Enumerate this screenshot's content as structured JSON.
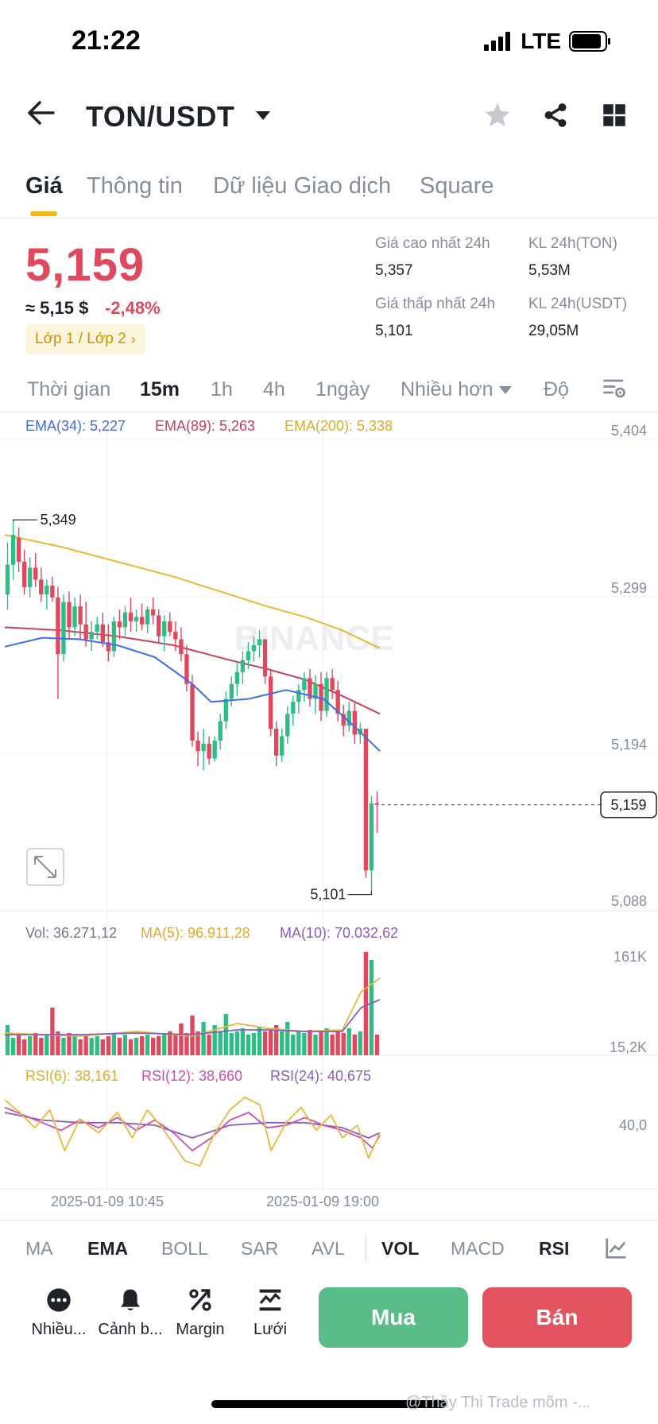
{
  "status": {
    "time": "21:22",
    "network": "LTE"
  },
  "header": {
    "pair": "TON/USDT"
  },
  "tabs": [
    {
      "label": "Giá",
      "active": true
    },
    {
      "label": "Thông tin",
      "active": false
    },
    {
      "label": "Dữ liệu Giao dịch",
      "active": false
    },
    {
      "label": "Square",
      "active": false
    }
  ],
  "price": {
    "last": "5,159",
    "usd": "≈ 5,15 $",
    "change": "-2,48%",
    "layer_badge": "Lớp 1 / Lớp 2"
  },
  "stats": {
    "high_label": "Giá cao nhất 24h",
    "high": "5,357",
    "low_label": "Giá thấp nhất 24h",
    "low": "5,101",
    "vol_ton_label": "KL 24h(TON)",
    "vol_ton": "5,53M",
    "vol_usdt_label": "KL 24h(USDT)",
    "vol_usdt": "29,05M"
  },
  "intervals": [
    {
      "label": "Thời gian",
      "active": false
    },
    {
      "label": "15m",
      "active": true
    },
    {
      "label": "1h",
      "active": false
    },
    {
      "label": "4h",
      "active": false
    },
    {
      "label": "1ngày",
      "active": false
    },
    {
      "label": "Nhiều hơn",
      "active": false
    },
    {
      "label": "Độ",
      "active": false
    }
  ],
  "indicators": {
    "ema34": "EMA(34): 5,227",
    "ema89": "EMA(89): 5,263",
    "ema200": "EMA(200): 5,338",
    "vol": "Vol: 36.271,12",
    "ma5": "MA(5): 96.911,28",
    "ma10": "MA(10): 70.032,62",
    "rsi6": "RSI(6): 38,161",
    "rsi12": "RSI(12): 38,660",
    "rsi24": "RSI(24): 40,675"
  },
  "colors": {
    "up": "#2ebd85",
    "down": "#e0485e",
    "ema34": "#3f6ee6",
    "ema89": "#c8405a",
    "ema200": "#e6b93c",
    "ma5": "#e6b93c",
    "ma10": "#8a5cc0",
    "rsi6": "#e6b93c",
    "rsi12": "#c850b0",
    "rsi24": "#8a5cc0",
    "buy": "#58bd86",
    "sell": "#e3525f",
    "accent": "#f0b90b"
  },
  "chart_data": {
    "type": "candlestick",
    "price_axis_ticks": [
      "5,404",
      "5,299",
      "5,194",
      "5,088"
    ],
    "price_ylim": [
      5.088,
      5.404
    ],
    "current_price_label": "5,159",
    "current_price": 5.159,
    "high_marker": "5,349",
    "low_marker": "5,101",
    "volume_axis_ticks": [
      "161K",
      "15,2K"
    ],
    "rsi_axis_ticks": [
      "40,0"
    ],
    "x_tick_labels": [
      "2025-01-09 10:45",
      "2025-01-09 19:00"
    ],
    "candles_ohlc": [
      [
        5.3,
        5.335,
        5.29,
        5.32
      ],
      [
        5.32,
        5.349,
        5.31,
        5.34
      ],
      [
        5.338,
        5.345,
        5.315,
        5.322
      ],
      [
        5.322,
        5.33,
        5.3,
        5.305
      ],
      [
        5.305,
        5.325,
        5.298,
        5.318
      ],
      [
        5.318,
        5.328,
        5.305,
        5.31
      ],
      [
        5.31,
        5.318,
        5.295,
        5.3
      ],
      [
        5.3,
        5.31,
        5.29,
        5.306
      ],
      [
        5.306,
        5.312,
        5.295,
        5.298
      ],
      [
        5.298,
        5.305,
        5.23,
        5.26
      ],
      [
        5.26,
        5.3,
        5.255,
        5.295
      ],
      [
        5.295,
        5.302,
        5.27,
        5.278
      ],
      [
        5.278,
        5.298,
        5.272,
        5.292
      ],
      [
        5.292,
        5.3,
        5.27,
        5.28
      ],
      [
        5.28,
        5.295,
        5.265,
        5.27
      ],
      [
        5.27,
        5.282,
        5.262,
        5.275
      ],
      [
        5.275,
        5.285,
        5.27,
        5.28
      ],
      [
        5.28,
        5.288,
        5.265,
        5.268
      ],
      [
        5.268,
        5.28,
        5.255,
        5.262
      ],
      [
        5.262,
        5.285,
        5.258,
        5.282
      ],
      [
        5.282,
        5.29,
        5.27,
        5.278
      ],
      [
        5.278,
        5.292,
        5.272,
        5.288
      ],
      [
        5.288,
        5.298,
        5.275,
        5.282
      ],
      [
        5.282,
        5.29,
        5.275,
        5.285
      ],
      [
        5.285,
        5.294,
        5.276,
        5.28
      ],
      [
        5.28,
        5.292,
        5.274,
        5.29
      ],
      [
        5.29,
        5.298,
        5.28,
        5.286
      ],
      [
        5.286,
        5.29,
        5.268,
        5.272
      ],
      [
        5.272,
        5.286,
        5.262,
        5.282
      ],
      [
        5.282,
        5.288,
        5.272,
        5.275
      ],
      [
        5.275,
        5.282,
        5.262,
        5.27
      ],
      [
        5.27,
        5.278,
        5.255,
        5.26
      ],
      [
        5.26,
        5.266,
        5.235,
        5.24
      ],
      [
        5.24,
        5.246,
        5.198,
        5.202
      ],
      [
        5.202,
        5.208,
        5.185,
        5.195
      ],
      [
        5.195,
        5.21,
        5.182,
        5.2
      ],
      [
        5.2,
        5.205,
        5.186,
        5.19
      ],
      [
        5.19,
        5.205,
        5.188,
        5.202
      ],
      [
        5.202,
        5.22,
        5.196,
        5.215
      ],
      [
        5.215,
        5.235,
        5.21,
        5.23
      ],
      [
        5.23,
        5.245,
        5.225,
        5.24
      ],
      [
        5.24,
        5.255,
        5.232,
        5.248
      ],
      [
        5.248,
        5.262,
        5.24,
        5.256
      ],
      [
        5.256,
        5.268,
        5.25,
        5.262
      ],
      [
        5.262,
        5.272,
        5.255,
        5.266
      ],
      [
        5.266,
        5.276,
        5.258,
        5.27
      ],
      [
        5.27,
        5.27,
        5.24,
        5.245
      ],
      [
        5.245,
        5.25,
        5.205,
        5.21
      ],
      [
        5.21,
        5.215,
        5.185,
        5.192
      ],
      [
        5.192,
        5.21,
        5.188,
        5.205
      ],
      [
        5.205,
        5.225,
        5.2,
        5.22
      ],
      [
        5.22,
        5.232,
        5.212,
        5.228
      ],
      [
        5.228,
        5.24,
        5.22,
        5.236
      ],
      [
        5.236,
        5.248,
        5.228,
        5.244
      ],
      [
        5.244,
        5.25,
        5.225,
        5.23
      ],
      [
        5.23,
        5.246,
        5.22,
        5.24
      ],
      [
        5.24,
        5.248,
        5.215,
        5.222
      ],
      [
        5.222,
        5.248,
        5.218,
        5.244
      ],
      [
        5.244,
        5.25,
        5.23,
        5.236
      ],
      [
        5.236,
        5.242,
        5.215,
        5.22
      ],
      [
        5.22,
        5.226,
        5.205,
        5.212
      ],
      [
        5.212,
        5.228,
        5.208,
        5.222
      ],
      [
        5.222,
        5.228,
        5.2,
        5.206
      ],
      [
        5.206,
        5.214,
        5.2,
        5.21
      ],
      [
        5.21,
        5.21,
        5.11,
        5.115
      ],
      [
        5.115,
        5.165,
        5.101,
        5.16
      ],
      [
        5.16,
        5.168,
        5.14,
        5.159
      ]
    ],
    "ema200_curve": [
      [
        0,
        5.34
      ],
      [
        0.15,
        5.332
      ],
      [
        0.3,
        5.322
      ],
      [
        0.45,
        5.312
      ],
      [
        0.6,
        5.3
      ],
      [
        0.7,
        5.292
      ],
      [
        0.8,
        5.285
      ],
      [
        0.9,
        5.276
      ],
      [
        1,
        5.264
      ]
    ],
    "ema89_curve": [
      [
        0,
        5.278
      ],
      [
        0.15,
        5.276
      ],
      [
        0.3,
        5.272
      ],
      [
        0.45,
        5.266
      ],
      [
        0.6,
        5.256
      ],
      [
        0.7,
        5.25
      ],
      [
        0.8,
        5.243
      ],
      [
        0.9,
        5.232
      ],
      [
        1,
        5.22
      ]
    ],
    "ema34_curve": [
      [
        0,
        5.265
      ],
      [
        0.1,
        5.271
      ],
      [
        0.2,
        5.27
      ],
      [
        0.3,
        5.266
      ],
      [
        0.4,
        5.258
      ],
      [
        0.5,
        5.24
      ],
      [
        0.55,
        5.228
      ],
      [
        0.65,
        5.23
      ],
      [
        0.75,
        5.236
      ],
      [
        0.85,
        5.23
      ],
      [
        0.93,
        5.212
      ],
      [
        1,
        5.195
      ]
    ],
    "volume_values": [
      38,
      22,
      25,
      20,
      24,
      28,
      22,
      26,
      60,
      30,
      22,
      28,
      24,
      20,
      26,
      22,
      24,
      20,
      24,
      28,
      22,
      26,
      20,
      22,
      24,
      26,
      22,
      24,
      28,
      30,
      26,
      40,
      28,
      50,
      30,
      42,
      26,
      38,
      30,
      52,
      28,
      30,
      34,
      26,
      28,
      36,
      30,
      32,
      38,
      30,
      42,
      26,
      30,
      28,
      32,
      26,
      30,
      34,
      26,
      30,
      28,
      34,
      26,
      30,
      130,
      120,
      26
    ],
    "ma5_curve": [
      [
        0,
        28
      ],
      [
        0.2,
        24
      ],
      [
        0.35,
        30
      ],
      [
        0.5,
        24
      ],
      [
        0.62,
        40
      ],
      [
        0.7,
        34
      ],
      [
        0.8,
        30
      ],
      [
        0.9,
        32
      ],
      [
        0.95,
        80
      ],
      [
        1,
        97
      ]
    ],
    "ma10_curve": [
      [
        0,
        26
      ],
      [
        0.2,
        26
      ],
      [
        0.35,
        28
      ],
      [
        0.5,
        26
      ],
      [
        0.62,
        32
      ],
      [
        0.7,
        32
      ],
      [
        0.8,
        30
      ],
      [
        0.9,
        30
      ],
      [
        0.95,
        60
      ],
      [
        1,
        70
      ]
    ],
    "rsi6_curve": [
      [
        0,
        70
      ],
      [
        0.04,
        60
      ],
      [
        0.08,
        48
      ],
      [
        0.12,
        62
      ],
      [
        0.16,
        30
      ],
      [
        0.2,
        55
      ],
      [
        0.25,
        44
      ],
      [
        0.3,
        60
      ],
      [
        0.34,
        40
      ],
      [
        0.38,
        62
      ],
      [
        0.42,
        48
      ],
      [
        0.48,
        22
      ],
      [
        0.52,
        18
      ],
      [
        0.56,
        44
      ],
      [
        0.6,
        62
      ],
      [
        0.64,
        72
      ],
      [
        0.68,
        66
      ],
      [
        0.71,
        30
      ],
      [
        0.75,
        52
      ],
      [
        0.79,
        64
      ],
      [
        0.83,
        46
      ],
      [
        0.87,
        58
      ],
      [
        0.9,
        40
      ],
      [
        0.94,
        50
      ],
      [
        0.97,
        24
      ],
      [
        1,
        44
      ]
    ],
    "rsi12_curve": [
      [
        0,
        64
      ],
      [
        0.05,
        58
      ],
      [
        0.1,
        52
      ],
      [
        0.15,
        46
      ],
      [
        0.2,
        54
      ],
      [
        0.25,
        48
      ],
      [
        0.3,
        56
      ],
      [
        0.35,
        46
      ],
      [
        0.4,
        54
      ],
      [
        0.45,
        44
      ],
      [
        0.5,
        30
      ],
      [
        0.55,
        40
      ],
      [
        0.6,
        54
      ],
      [
        0.65,
        60
      ],
      [
        0.7,
        48
      ],
      [
        0.75,
        50
      ],
      [
        0.8,
        56
      ],
      [
        0.85,
        50
      ],
      [
        0.9,
        46
      ],
      [
        0.95,
        40
      ],
      [
        0.98,
        32
      ],
      [
        1,
        42
      ]
    ],
    "rsi24_curve": [
      [
        0,
        60
      ],
      [
        0.1,
        54
      ],
      [
        0.2,
        52
      ],
      [
        0.3,
        52
      ],
      [
        0.4,
        50
      ],
      [
        0.5,
        40
      ],
      [
        0.6,
        50
      ],
      [
        0.7,
        52
      ],
      [
        0.8,
        52
      ],
      [
        0.9,
        48
      ],
      [
        0.97,
        40
      ],
      [
        1,
        44
      ]
    ]
  },
  "indicator_tabs": [
    {
      "label": "MA",
      "active": false
    },
    {
      "label": "EMA",
      "active": true
    },
    {
      "label": "BOLL",
      "active": false
    },
    {
      "label": "SAR",
      "active": false
    },
    {
      "label": "AVL",
      "active": false
    },
    {
      "label": "VOL",
      "active": true
    },
    {
      "label": "MACD",
      "active": false
    },
    {
      "label": "RSI",
      "active": true
    }
  ],
  "actions": [
    {
      "label": "Nhiều...",
      "icon": "more-icon"
    },
    {
      "label": "Cảnh b...",
      "icon": "bell-icon"
    },
    {
      "label": "Margin",
      "icon": "margin-icon"
    },
    {
      "label": "Lưới",
      "icon": "grid-trading-icon"
    }
  ],
  "buttons": {
    "buy": "Mua",
    "sell": "Bán"
  },
  "chart_watermark": "BINANCE",
  "watermark": "@Thầy Thi Trade mõm -..."
}
